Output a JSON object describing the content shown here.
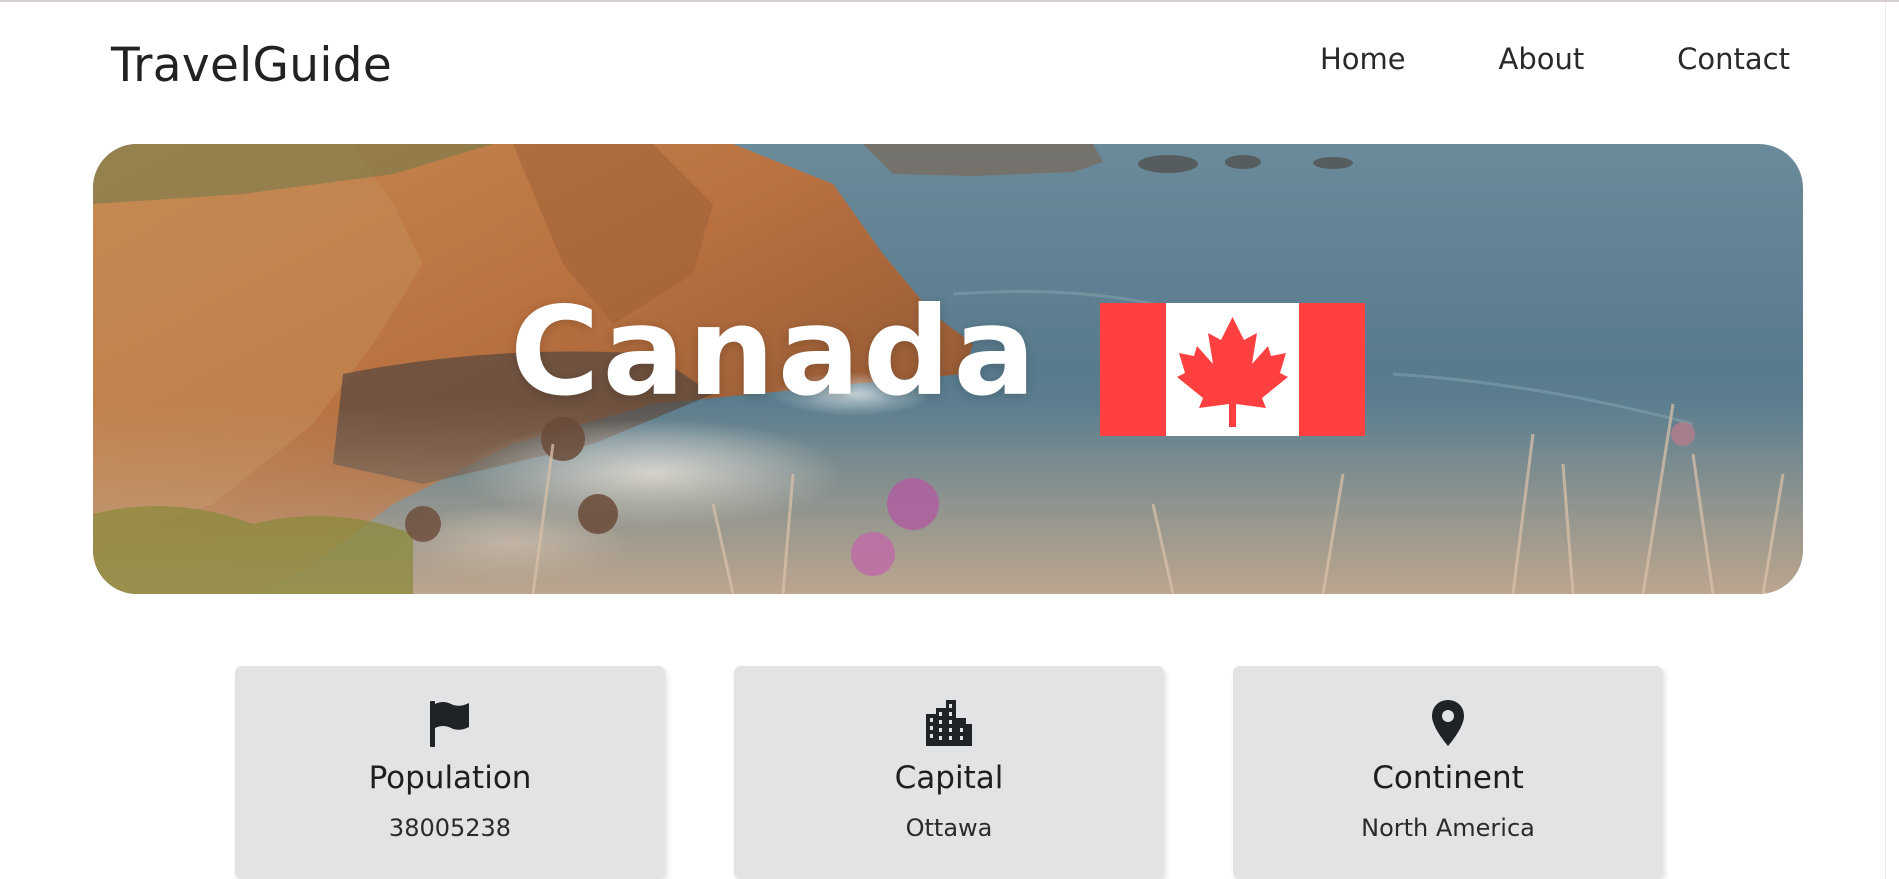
{
  "header": {
    "brand": "TravelGuide",
    "nav": [
      "Home",
      "About",
      "Contact"
    ]
  },
  "hero": {
    "country": "Canada",
    "flag_colors": {
      "red": "#ff4040",
      "white": "#ffffff"
    }
  },
  "cards": [
    {
      "icon": "flag-icon",
      "title": "Population",
      "value": "38005238"
    },
    {
      "icon": "city-icon",
      "title": "Capital",
      "value": "Ottawa"
    },
    {
      "icon": "map-pin-icon",
      "title": "Continent",
      "value": "North America"
    }
  ],
  "colors": {
    "card_bg": "#e2e3e5",
    "text": "#222222"
  }
}
